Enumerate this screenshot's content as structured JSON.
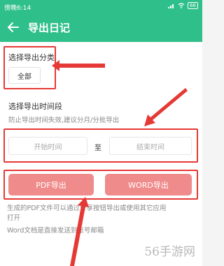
{
  "status_bar": {
    "time": "傍晚6:14",
    "battery": "66"
  },
  "header": {
    "title": "导出日记"
  },
  "category": {
    "label": "选择导出分类",
    "all_button": "全部"
  },
  "time_range": {
    "label": "选择导出时间段",
    "hint": "防止导出时间失效,建议分月/分批导出",
    "start_placeholder": "开始时间",
    "to_label": "至",
    "end_placeholder": "结束时间"
  },
  "export": {
    "pdf_button": "PDF导出",
    "word_button": "WORD导出"
  },
  "notes": {
    "line1": "生成的PDF文件可以通过分享按钮导出或使用其它应用",
    "line2": "打开",
    "line3": "Word文档是直接发送到账号邮箱"
  },
  "watermark": "56手游网",
  "colors": {
    "header_green": "#2fbf8a",
    "export_button": "#f08b8b",
    "annotation_red": "#e53935"
  }
}
